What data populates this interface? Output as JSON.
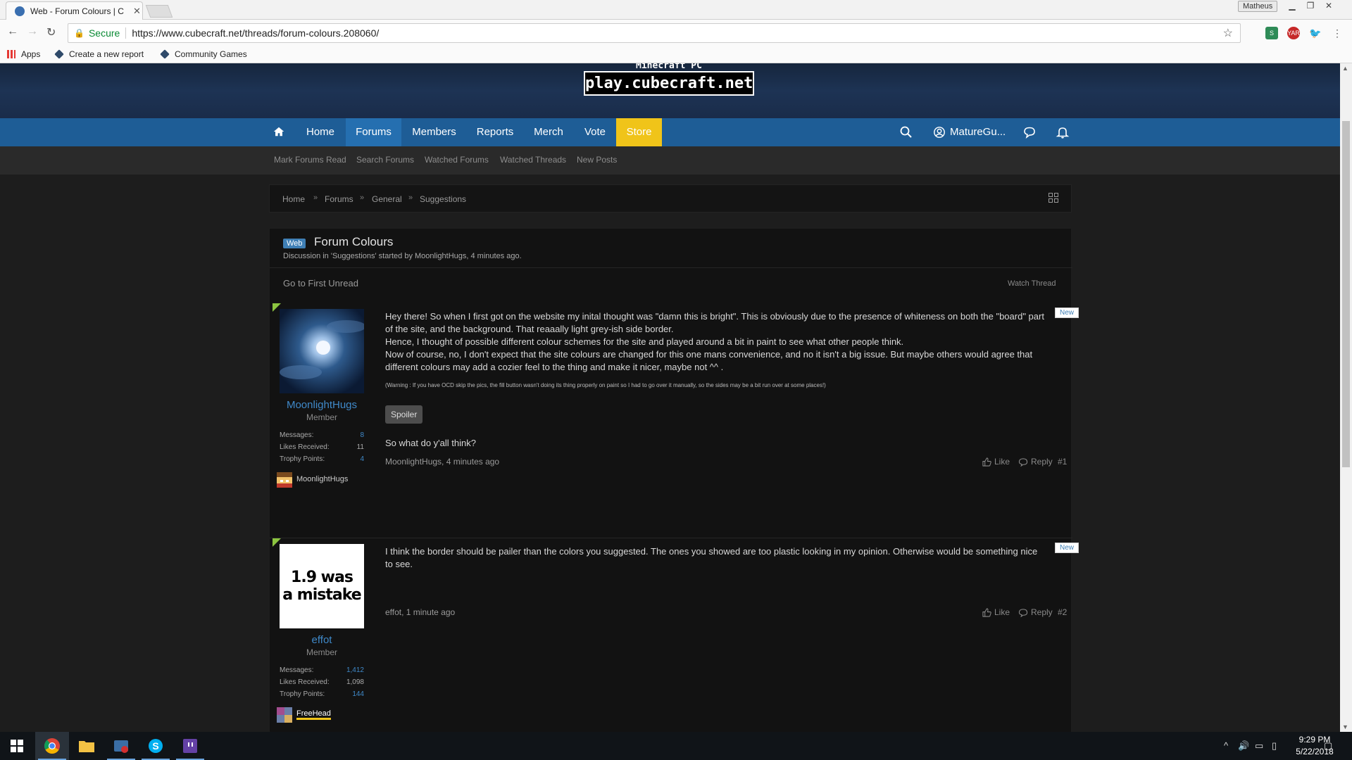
{
  "browser": {
    "tab_title": "Web - Forum Colours | C",
    "tab_close": "✕",
    "window_user": "Matheus",
    "url_secure_label": "Secure",
    "url": "https://www.cubecraft.net/threads/forum-colours.208060/",
    "bookmarks": [
      "Apps",
      "Create a new report",
      "Community Games"
    ]
  },
  "hero": {
    "ip_label": "Minecraft PC IP:",
    "ip": "play.cubecraft.net"
  },
  "nav": {
    "items": [
      "Home",
      "Forums",
      "Members",
      "Reports",
      "Merch",
      "Vote",
      "Store"
    ],
    "user": "MatureGu..."
  },
  "subnav": [
    "Mark Forums Read",
    "Search Forums",
    "Watched Forums",
    "Watched Threads",
    "New Posts"
  ],
  "breadcrumb": [
    "Home",
    "Forums",
    "General",
    "Suggestions"
  ],
  "thread": {
    "prefix": "Web",
    "title": "Forum Colours",
    "meta": "Discussion in 'Suggestions' started by MoonlightHugs, 4 minutes ago.",
    "goto_unread": "Go to First Unread",
    "watch": "Watch Thread"
  },
  "posts": [
    {
      "username": "MoonlightHugs",
      "user_title": "Member",
      "stats": [
        {
          "label": "Messages:",
          "value": "8"
        },
        {
          "label": "Likes Received:",
          "value": "11"
        },
        {
          "label": "Trophy Points:",
          "value": "4"
        }
      ],
      "badge_name": "MoonlightHugs",
      "new_tag": "New",
      "body": [
        "Hey there! So when I first got on the website my inital thought was \"damn this is bright\". This is obviously due to the presence of whiteness on both the \"board\" part of the site, and the background. That reaaally light grey-ish side border.",
        "Hence, I thought of possible different colour schemes for the site and played around a bit in paint to see what other people think.",
        "Now of course, no, I don't expect that the site colours are changed for this one mans convenience, and no it isn't a big issue. But maybe others would agree that different colours may add a cozier feel to the thing and make it nicer, maybe not ^^ ."
      ],
      "warning": "(Warning : If you have OCD skip the pics, the fill button wasn't doing its thing properly on paint so I had to go over it manually, so the sides may be a bit run over at some places!)",
      "spoiler": "Spoiler",
      "closing": "So what do y'all think?",
      "footer": "MoonlightHugs, 4 minutes ago",
      "like": "Like",
      "reply": "Reply",
      "number": "#1"
    },
    {
      "username": "effot",
      "user_title": "Member",
      "avatar_text_1": "1.9 was",
      "avatar_text_2": "a mistake",
      "stats": [
        {
          "label": "Messages:",
          "value": "1,412"
        },
        {
          "label": "Likes Received:",
          "value": "1,098"
        },
        {
          "label": "Trophy Points:",
          "value": "144"
        }
      ],
      "badge_name": "FreeHead",
      "new_tag": "New",
      "body": [
        "I think the border should be pailer than the colors you suggested. The ones you showed are too plastic looking in my opinion. Otherwise would be something nice to see."
      ],
      "footer": "effot, 1 minute ago",
      "like": "Like",
      "reply": "Reply",
      "number": "#2"
    }
  ],
  "taskbar": {
    "time": "9:29 PM",
    "date": "5/22/2018"
  },
  "colors": {
    "nav_blue": "#1e5d96",
    "store_yellow": "#f0c419",
    "link_blue": "#3f89c9",
    "new_corner_green": "#8cc540"
  }
}
